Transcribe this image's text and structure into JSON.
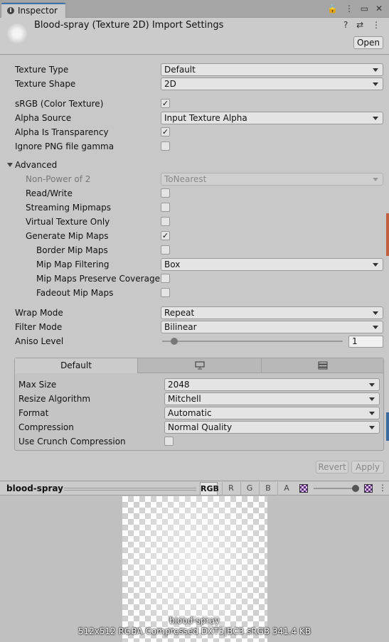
{
  "tab": {
    "label": "Inspector"
  },
  "window_icons": "🔒 ⋮ ▭ ✕",
  "header": {
    "title": "Blood-spray (Texture 2D) Import Settings",
    "icons": "? ⇄ ⋮",
    "open_label": "Open"
  },
  "fields": {
    "texture_type": {
      "label": "Texture Type",
      "value": "Default"
    },
    "texture_shape": {
      "label": "Texture Shape",
      "value": "2D"
    },
    "srgb": {
      "label": "sRGB (Color Texture)",
      "checked": "✓"
    },
    "alpha_source": {
      "label": "Alpha Source",
      "value": "Input Texture Alpha"
    },
    "alpha_transparency": {
      "label": "Alpha Is Transparency",
      "checked": "✓"
    },
    "ignore_png_gamma": {
      "label": "Ignore PNG file gamma",
      "checked": ""
    }
  },
  "advanced": {
    "label": "Advanced",
    "non_power_of_2": {
      "label": "Non-Power of 2",
      "value": "ToNearest"
    },
    "read_write": {
      "label": "Read/Write",
      "checked": ""
    },
    "streaming_mipmaps": {
      "label": "Streaming Mipmaps",
      "checked": ""
    },
    "virtual_texture": {
      "label": "Virtual Texture Only",
      "checked": ""
    },
    "generate_mip": {
      "label": "Generate Mip Maps",
      "checked": "✓"
    },
    "border_mip": {
      "label": "Border Mip Maps",
      "checked": ""
    },
    "mip_filtering": {
      "label": "Mip Map Filtering",
      "value": "Box"
    },
    "mip_preserve": {
      "label": "Mip Maps Preserve Coverage",
      "checked": ""
    },
    "fadeout_mip": {
      "label": "Fadeout Mip Maps",
      "checked": ""
    }
  },
  "wrap": {
    "wrap_mode": {
      "label": "Wrap Mode",
      "value": "Repeat"
    },
    "filter_mode": {
      "label": "Filter Mode",
      "value": "Bilinear"
    },
    "aniso": {
      "label": "Aniso Level",
      "value": "1"
    }
  },
  "platform": {
    "tabs": [
      "Default",
      "",
      ""
    ],
    "max_size": {
      "label": "Max Size",
      "value": "2048"
    },
    "resize": {
      "label": "Resize Algorithm",
      "value": "Mitchell"
    },
    "format": {
      "label": "Format",
      "value": "Automatic"
    },
    "compression": {
      "label": "Compression",
      "value": "Normal Quality"
    },
    "crunch": {
      "label": "Use Crunch Compression",
      "checked": ""
    }
  },
  "actions": {
    "revert": "Revert",
    "apply": "Apply"
  },
  "preview": {
    "title": "blood-spray",
    "channels": [
      "RGB",
      "R",
      "G",
      "B",
      "A"
    ],
    "name": "blood-spray",
    "info": "512x512  RGBA Compressed DXT5|BC3 sRGB   341.4 KB"
  }
}
